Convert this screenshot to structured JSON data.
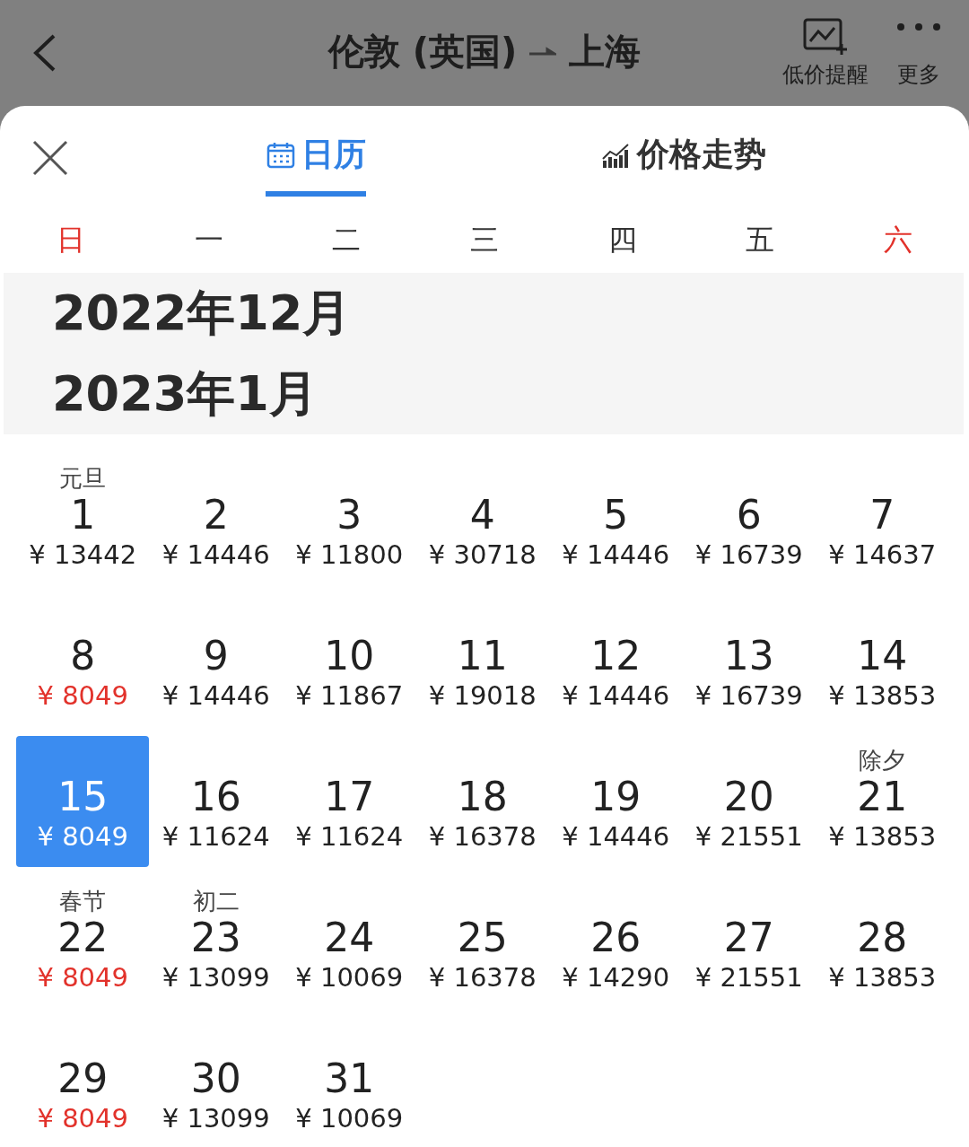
{
  "header": {
    "origin": "伦敦 (英国)",
    "destination": "上海",
    "actions": [
      {
        "label": "低价提醒",
        "kind": "alert"
      },
      {
        "label": "更多",
        "kind": "more"
      }
    ]
  },
  "tabs": [
    {
      "label": "日历",
      "kind": "calendar",
      "selected": true
    },
    {
      "label": "价格走势",
      "kind": "trend",
      "selected": false
    }
  ],
  "weekdays": [
    {
      "label": "日",
      "weekend": true
    },
    {
      "label": "一",
      "weekend": false
    },
    {
      "label": "二",
      "weekend": false
    },
    {
      "label": "三",
      "weekend": false
    },
    {
      "label": "四",
      "weekend": false
    },
    {
      "label": "五",
      "weekend": false
    },
    {
      "label": "六",
      "weekend": true
    }
  ],
  "months": [
    "2022年12月",
    "2023年1月"
  ],
  "days": [
    {
      "day": "1",
      "price": "¥ 13442",
      "holiday": "元旦",
      "low": false,
      "selected": false
    },
    {
      "day": "2",
      "price": "¥ 14446",
      "low": false,
      "selected": false
    },
    {
      "day": "3",
      "price": "¥ 11800",
      "low": false,
      "selected": false
    },
    {
      "day": "4",
      "price": "¥ 30718",
      "low": false,
      "selected": false
    },
    {
      "day": "5",
      "price": "¥ 14446",
      "low": false,
      "selected": false
    },
    {
      "day": "6",
      "price": "¥ 16739",
      "low": false,
      "selected": false
    },
    {
      "day": "7",
      "price": "¥ 14637",
      "low": false,
      "selected": false
    },
    {
      "day": "8",
      "price": "¥ 8049",
      "low": true,
      "selected": false
    },
    {
      "day": "9",
      "price": "¥ 14446",
      "low": false,
      "selected": false
    },
    {
      "day": "10",
      "price": "¥ 11867",
      "low": false,
      "selected": false
    },
    {
      "day": "11",
      "price": "¥ 19018",
      "low": false,
      "selected": false
    },
    {
      "day": "12",
      "price": "¥ 14446",
      "low": false,
      "selected": false
    },
    {
      "day": "13",
      "price": "¥ 16739",
      "low": false,
      "selected": false
    },
    {
      "day": "14",
      "price": "¥ 13853",
      "low": false,
      "selected": false
    },
    {
      "day": "15",
      "price": "¥ 8049",
      "low": true,
      "selected": true
    },
    {
      "day": "16",
      "price": "¥ 11624",
      "low": false,
      "selected": false
    },
    {
      "day": "17",
      "price": "¥ 11624",
      "low": false,
      "selected": false
    },
    {
      "day": "18",
      "price": "¥ 16378",
      "low": false,
      "selected": false
    },
    {
      "day": "19",
      "price": "¥ 14446",
      "low": false,
      "selected": false
    },
    {
      "day": "20",
      "price": "¥ 21551",
      "low": false,
      "selected": false
    },
    {
      "day": "21",
      "price": "¥ 13853",
      "holiday": "除夕",
      "low": false,
      "selected": false
    },
    {
      "day": "22",
      "price": "¥ 8049",
      "holiday": "春节",
      "low": true,
      "selected": false
    },
    {
      "day": "23",
      "price": "¥ 13099",
      "holiday": "初二",
      "low": false,
      "selected": false
    },
    {
      "day": "24",
      "price": "¥ 10069",
      "low": false,
      "selected": false
    },
    {
      "day": "25",
      "price": "¥ 16378",
      "low": false,
      "selected": false
    },
    {
      "day": "26",
      "price": "¥ 14290",
      "low": false,
      "selected": false
    },
    {
      "day": "27",
      "price": "¥ 21551",
      "low": false,
      "selected": false
    },
    {
      "day": "28",
      "price": "¥ 13853",
      "low": false,
      "selected": false
    },
    {
      "day": "29",
      "price": "¥ 8049",
      "low": true,
      "selected": false
    },
    {
      "day": "30",
      "price": "¥ 13099",
      "low": false,
      "selected": false
    },
    {
      "day": "31",
      "price": "¥ 10069",
      "low": false,
      "selected": false
    }
  ]
}
